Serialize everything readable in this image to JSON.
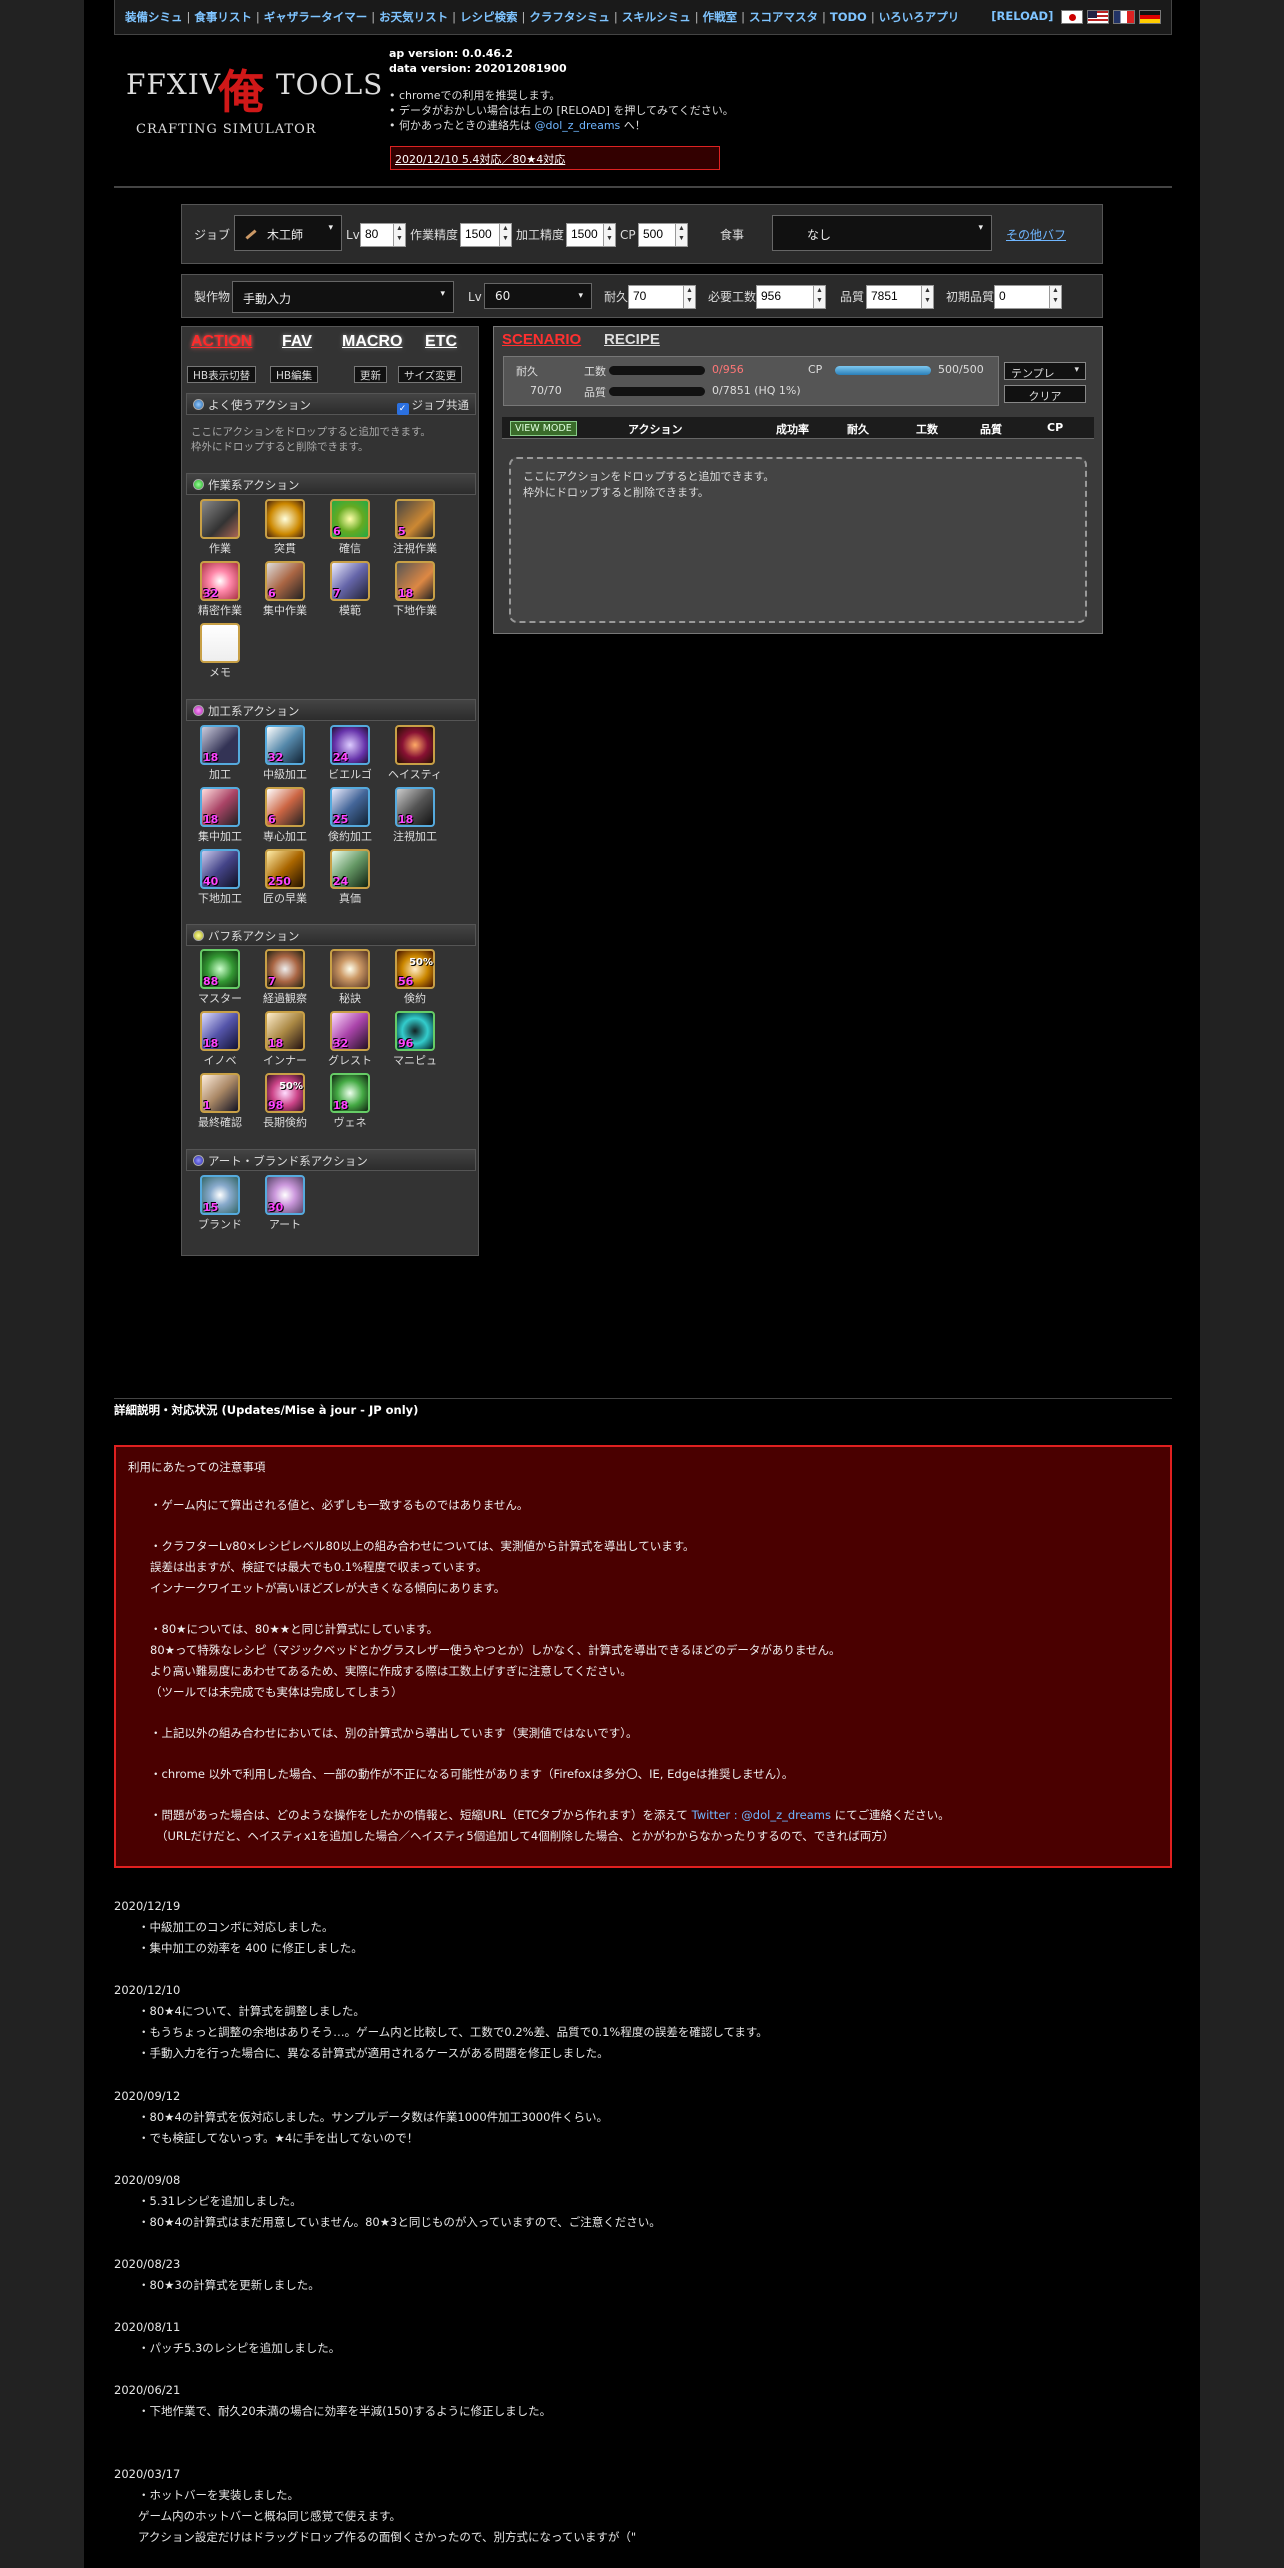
{
  "topnav": {
    "links": [
      "装備シミュ",
      "食事リスト",
      "ギャザラータイマー",
      "お天気リスト",
      "レシピ検索",
      "クラフタシミュ",
      "スキルシミュ",
      "作戦室",
      "スコアマスタ",
      "TODO",
      "いろいろアプリ"
    ],
    "reload": "[RELOAD]"
  },
  "header": {
    "logo_left": "FFXIV",
    "logo_kanji": "俺",
    "logo_right": "TOOLS",
    "logo_sub": "CRAFTING SIMULATOR",
    "ap_version": "ap version: 0.0.46.2",
    "data_version": "data version: 202012081900",
    "notes": [
      "chromeでの利用を推奨します。",
      "データがおかしい場合は右上の [RELOAD] を押してみてください。"
    ],
    "contact_prefix": "何かあったときの連絡先は ",
    "contact_link": "@dol_z_dreams",
    "contact_suffix": " へ！",
    "notice": "2020/12/10 5.4対応／80★4対応"
  },
  "jobbar": {
    "job_label": "ジョブ",
    "job_value": "木工師",
    "lv_label": "Lv",
    "lv_value": "80",
    "craftsmanship_label": "作業精度",
    "craftsmanship_value": "1500",
    "control_label": "加工精度",
    "control_value": "1500",
    "cp_label": "CP",
    "cp_value": "500",
    "food_label": "食事",
    "food_value": "なし",
    "buff_link": "その他バフ"
  },
  "recipebar": {
    "item_label": "製作物",
    "item_value": "手動入力",
    "lv_label": "Lv",
    "lv_value": "60",
    "durability_label": "耐久",
    "durability_value": "70",
    "progress_label": "必要工数",
    "progress_value": "956",
    "quality_label": "品質",
    "quality_value": "7851",
    "initial_quality_label": "初期品質",
    "initial_quality_value": "0"
  },
  "leftpanel": {
    "tabs": [
      "ACTION",
      "FAV",
      "MACRO",
      "ETC"
    ],
    "buttons": [
      "HB表示切替",
      "HB編集",
      "更新",
      "サイズ変更"
    ],
    "fav_header": "よく使うアクション",
    "share_label": "ジョブ共通",
    "fav_hint1": "ここにアクションをドロップすると追加できます。",
    "fav_hint2": "枠外にドロップすると削除できます。",
    "sections": [
      "作業系アクション",
      "加工系アクション",
      "バフ系アクション",
      "アート・ブランド系アクション"
    ],
    "synth": [
      {
        "name": "作業",
        "num": ""
      },
      {
        "name": "突貫",
        "num": ""
      },
      {
        "name": "確信",
        "num": "6"
      },
      {
        "name": "注視作業",
        "num": "5"
      },
      {
        "name": "精密作業",
        "num": "32"
      },
      {
        "name": "集中作業",
        "num": "6"
      },
      {
        "name": "模範",
        "num": "7"
      },
      {
        "name": "下地作業",
        "num": "18"
      },
      {
        "name": "メモ",
        "num": ""
      }
    ],
    "touch": [
      {
        "name": "加工",
        "num": "18"
      },
      {
        "name": "中級加工",
        "num": "32"
      },
      {
        "name": "ビエルゴ",
        "num": "24"
      },
      {
        "name": "ヘイスティ",
        "num": ""
      },
      {
        "name": "集中加工",
        "num": "18"
      },
      {
        "name": "専心加工",
        "num": "6"
      },
      {
        "name": "倹約加工",
        "num": "25"
      },
      {
        "name": "注視加工",
        "num": "18"
      },
      {
        "name": "下地加工",
        "num": "40"
      },
      {
        "name": "匠の早業",
        "num": "250"
      },
      {
        "name": "真価",
        "num": "24"
      }
    ],
    "buff": [
      {
        "name": "マスター",
        "num": "88",
        "pct": ""
      },
      {
        "name": "経過観察",
        "num": "7",
        "pct": ""
      },
      {
        "name": "秘訣",
        "num": "",
        "pct": ""
      },
      {
        "name": "倹約",
        "num": "56",
        "pct": "50%"
      },
      {
        "name": "イノベ",
        "num": "18",
        "pct": ""
      },
      {
        "name": "インナー",
        "num": "18",
        "pct": ""
      },
      {
        "name": "グレスト",
        "num": "32",
        "pct": ""
      },
      {
        "name": "マニピュ",
        "num": "96",
        "pct": ""
      },
      {
        "name": "最終確認",
        "num": "1",
        "pct": ""
      },
      {
        "name": "長期倹約",
        "num": "98",
        "pct": "50%"
      },
      {
        "name": "ヴェネ",
        "num": "18",
        "pct": ""
      }
    ],
    "art": [
      {
        "name": "ブランド",
        "num": "15"
      },
      {
        "name": "アート",
        "num": "30"
      }
    ]
  },
  "rightpanel": {
    "tab_scenario": "SCENARIO",
    "tab_recipe": "RECIPE",
    "durability_label": "耐久",
    "durability_value": "70/70",
    "progress_label": "工数",
    "progress_value": "0/956",
    "progress_fraction": 0,
    "quality_label": "品質",
    "quality_value": "0/7851 (HQ 1%)",
    "quality_fraction": 0,
    "cp_label": "CP",
    "cp_value": "500/500",
    "cp_fraction": 1,
    "template_label": "テンプレ",
    "clear_label": "クリア",
    "view_mode": "VIEW MODE",
    "columns": [
      "アクション",
      "成功率",
      "耐久",
      "工数",
      "品質",
      "CP"
    ],
    "drop_hint1": "ここにアクションをドロップすると追加できます。",
    "drop_hint2": "枠外にドロップすると削除できます。"
  },
  "info": {
    "title": "詳細説明・対応状況 (Updates/Mise à jour - JP only)",
    "caution_title": "利用にあたっての注意事項",
    "caution": [
      [
        "・ゲーム内にて算出される値と、必ずしも一致するものではありません。"
      ],
      [
        "・クラフターLv80×レシピレベル80以上の組み合わせについては、実測値から計算式を導出しています。",
        "誤差は出ますが、検証では最大でも0.1%程度で収まっています。",
        "インナークワイエットが高いほどズレが大きくなる傾向にあります。"
      ],
      [
        "・80★については、80★★と同じ計算式にしています。",
        "80★って特殊なレシピ（マジックベッドとかグラスレザー使うやつとか）しかなく、計算式を導出できるほどのデータがありません。",
        "より高い難易度にあわせてあるため、実際に作成する際は工数上げすぎに注意してください。",
        "（ツールでは未完成でも実体は完成してしまう）"
      ],
      [
        "・上記以外の組み合わせにおいては、別の計算式から導出しています（実測値ではないです）。"
      ],
      [
        "・chrome 以外で利用した場合、一部の動作が不正になる可能性があります（Firefoxは多分〇、IE, Edgeは推奨しません）。"
      ]
    ],
    "contact_prefix": "・問題があった場合は、どのような操作をしたかの情報と、短縮URL（ETCタブから作れます）を添えて ",
    "contact_link": "Twitter : @dol_z_dreams",
    "contact_suffix": " にてご連絡ください。",
    "contact_line2": "（URLだけだと、ヘイスティx1を追加した場合／ヘイスティ5個追加して4個削除した場合、とかがわからなかったりするので、できれば両方）",
    "log": [
      {
        "date": "2020/12/19",
        "items": [
          "・中級加工のコンボに対応しました。",
          "・集中加工の効率を 400 に修正しました。"
        ]
      },
      {
        "date": "2020/12/10",
        "items": [
          "・80★4について、計算式を調整しました。",
          "・もうちょっと調整の余地はありそう…。ゲーム内と比較して、工数で0.2%差、品質で0.1%程度の誤差を確認してます。",
          "・手動入力を行った場合に、異なる計算式が適用されるケースがある問題を修正しました。"
        ]
      },
      {
        "date": "2020/09/12",
        "items": [
          "・80★4の計算式を仮対応しました。サンプルデータ数は作業1000件加工3000件くらい。",
          "・でも検証してないっす。★4に手を出してないので！"
        ]
      },
      {
        "date": "2020/09/08",
        "items": [
          "・5.31レシピを追加しました。",
          "・80★4の計算式はまだ用意していません。80★3と同じものが入っていますので、ご注意ください。"
        ]
      },
      {
        "date": "2020/08/23",
        "items": [
          "・80★3の計算式を更新しました。"
        ]
      },
      {
        "date": "2020/08/11",
        "items": [
          "・パッチ5.3のレシピを追加しました。"
        ]
      },
      {
        "date": "2020/06/21",
        "items": [
          "・下地作業で、耐久20未満の場合に効率を半減(150)するように修正しました。"
        ]
      },
      {
        "date": "2020/03/17",
        "items": [
          "・ホットバーを実装しました。",
          "ゲーム内のホットバーと概ね同じ感覚で使えます。",
          "アクション設定だけはドラッグドロップ作るの面倒くさかったので、別方式になっていますが（\""
        ]
      }
    ]
  }
}
